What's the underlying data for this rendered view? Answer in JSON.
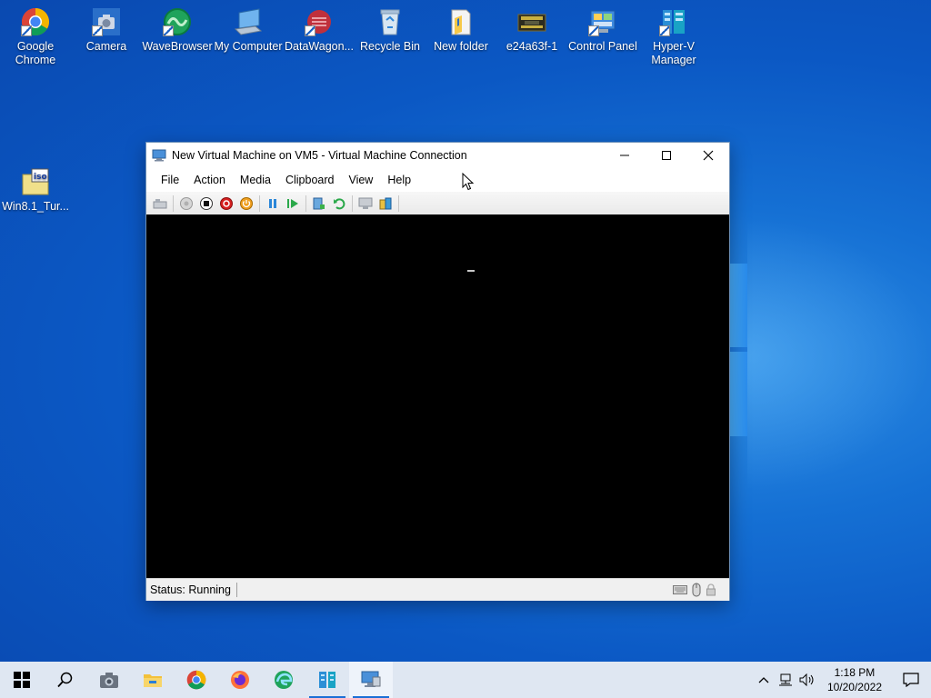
{
  "desktop": {
    "icons": [
      {
        "label": "Google Chrome",
        "icon": "chrome-icon"
      },
      {
        "label": "Camera",
        "icon": "camera-icon"
      },
      {
        "label": "WaveBrowser",
        "icon": "wavebrowser-icon"
      },
      {
        "label": "My Computer",
        "icon": "computer-icon"
      },
      {
        "label": "DataWagon...",
        "icon": "datawagon-icon"
      },
      {
        "label": "Recycle Bin",
        "icon": "recycle-bin-icon"
      },
      {
        "label": "New folder",
        "icon": "folder-icon"
      },
      {
        "label": "e24a63f-1",
        "icon": "image-file-icon"
      },
      {
        "label": "Control Panel",
        "icon": "control-panel-icon"
      },
      {
        "label": "Hyper-V Manager",
        "icon": "hyperv-manager-icon"
      },
      {
        "label": "Win8.1_Tur...",
        "icon": "iso-file-icon"
      }
    ]
  },
  "window": {
    "title": "New Virtual Machine on VM5 - Virtual Machine Connection",
    "menu": [
      "File",
      "Action",
      "Media",
      "Clipboard",
      "View",
      "Help"
    ],
    "toolbar": [
      "ctrl-alt-del-icon",
      "start-icon",
      "turn-off-icon",
      "shut-down-icon",
      "power-icon",
      "pause-icon",
      "resume-icon",
      "checkpoint-icon",
      "revert-icon",
      "enhanced-session-icon",
      "share-icon"
    ],
    "status": "Status: Running"
  },
  "taskbar": {
    "items": [
      "start-icon",
      "search-icon",
      "camera-icon",
      "file-explorer-icon",
      "chrome-icon",
      "firefox-icon",
      "edge-icon",
      "hyperv-manager-icon",
      "vm-connection-icon"
    ],
    "time": "1:18 PM",
    "date": "10/20/2022"
  },
  "colors": {
    "accent": "#1a6fd6",
    "desktop": "#0b58c4"
  }
}
